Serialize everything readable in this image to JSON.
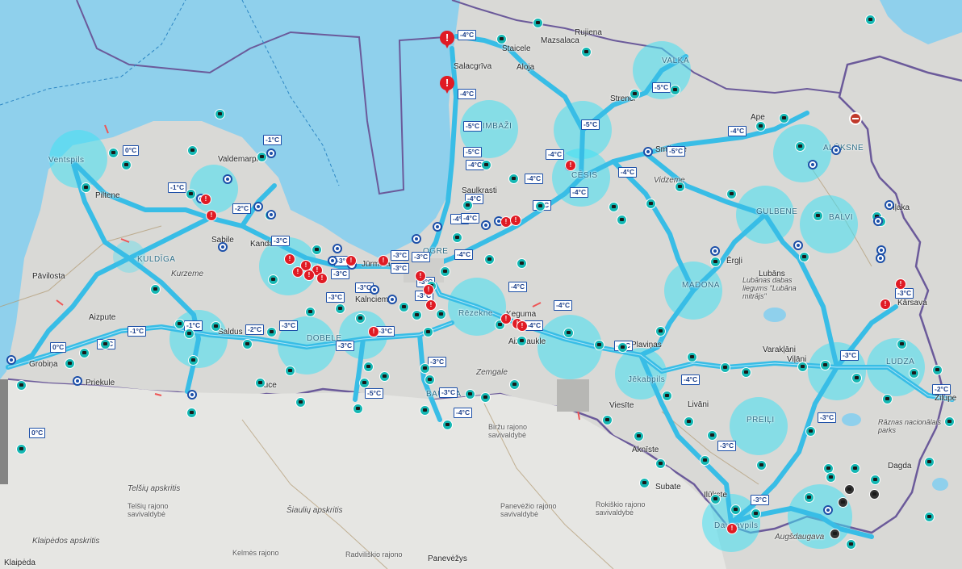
{
  "map": {
    "title": "",
    "colors": {
      "sea": "#8fd0ec",
      "land": "#d9d9d6",
      "road": "#38bde6",
      "zone": "#41e0f4",
      "border": "#6b5a9a",
      "alert": "#e01b24",
      "temp_text": "#1c3f8a"
    }
  },
  "places": [
    {
      "text": "Ventspils",
      "kind": "ct"
    },
    {
      "text": "Valdemarpils",
      "kind": "n"
    },
    {
      "text": "Piltene",
      "kind": "n"
    },
    {
      "text": "Sabile",
      "kind": "n"
    },
    {
      "text": "Kandava",
      "kind": "n"
    },
    {
      "text": "KULDĪGA",
      "kind": "ct"
    },
    {
      "text": "Kurzeme",
      "kind": "it"
    },
    {
      "text": "Pāvilosta",
      "kind": "n"
    },
    {
      "text": "Aizpute",
      "kind": "n"
    },
    {
      "text": "Saldus",
      "kind": "n"
    },
    {
      "text": "Grobiņa",
      "kind": "n"
    },
    {
      "text": "Priekule",
      "kind": "n"
    },
    {
      "text": "Auce",
      "kind": "n"
    },
    {
      "text": "DOBELE",
      "kind": "ct"
    },
    {
      "text": "Kalnciems",
      "kind": "n"
    },
    {
      "text": "Jūrmala",
      "kind": "n"
    },
    {
      "text": "Zemgale",
      "kind": "it"
    },
    {
      "text": "BAUSKA",
      "kind": "ct"
    },
    {
      "text": "Salacgrīva",
      "kind": "n"
    },
    {
      "text": "Staicele",
      "kind": "n"
    },
    {
      "text": "Aloja",
      "kind": "n"
    },
    {
      "text": "Mazsalaca",
      "kind": "n"
    },
    {
      "text": "Rujiena",
      "kind": "n"
    },
    {
      "text": "LIMBAŽI",
      "kind": "ct"
    },
    {
      "text": "VALKA",
      "kind": "ct"
    },
    {
      "text": "Strenči",
      "kind": "n"
    },
    {
      "text": "Saulkrasti",
      "kind": "n"
    },
    {
      "text": "CĒSIS",
      "kind": "ct"
    },
    {
      "text": "Vidzeme",
      "kind": "it"
    },
    {
      "text": "Smiltene",
      "kind": "n"
    },
    {
      "text": "Ape",
      "kind": "n"
    },
    {
      "text": "ALŪKSNE",
      "kind": "ct"
    },
    {
      "text": "GULBENE",
      "kind": "ct"
    },
    {
      "text": "BALVI",
      "kind": "ct"
    },
    {
      "text": "Viļaka",
      "kind": "n"
    },
    {
      "text": "Lubāns",
      "kind": "n"
    },
    {
      "text": "Lubānas dabas liegums \"Lubāna mitrājs\"",
      "kind": "it"
    },
    {
      "text": "MADONA",
      "kind": "ct"
    },
    {
      "text": "Ērgļi",
      "kind": "n"
    },
    {
      "text": "Varakļāni",
      "kind": "n"
    },
    {
      "text": "Viļāni",
      "kind": "n"
    },
    {
      "text": "Kārsava",
      "kind": "n"
    },
    {
      "text": "LUDZA",
      "kind": "ct"
    },
    {
      "text": "Zilupe",
      "kind": "n"
    },
    {
      "text": "Rāznas nacionālais parks",
      "kind": "it"
    },
    {
      "text": "Dagda",
      "kind": "n"
    },
    {
      "text": "OGRE",
      "kind": "ct"
    },
    {
      "text": "Ķeguma",
      "kind": "n"
    },
    {
      "text": "Aizkraukle",
      "kind": "n"
    },
    {
      "text": "Jēkabpils",
      "kind": "ct"
    },
    {
      "text": "Plaviņas",
      "kind": "n"
    },
    {
      "text": "Livāni",
      "kind": "n"
    },
    {
      "text": "Viesīte",
      "kind": "n"
    },
    {
      "text": "PREIĻI",
      "kind": "ct"
    },
    {
      "text": "Aknīste",
      "kind": "n"
    },
    {
      "text": "Subate",
      "kind": "n"
    },
    {
      "text": "Ilūkste",
      "kind": "n"
    },
    {
      "text": "Daugavpils",
      "kind": "ct"
    },
    {
      "text": "Augšdaugava",
      "kind": "it"
    },
    {
      "text": "Biržu rajono savivaldybė",
      "kind": "sm"
    },
    {
      "text": "Rokiškio rajono savivaldybė",
      "kind": "sm"
    },
    {
      "text": "Telšių apskritis",
      "kind": "it"
    },
    {
      "text": "Telšių rajono savivaldybė",
      "kind": "sm"
    },
    {
      "text": "Šiaulių apskritis",
      "kind": "it"
    },
    {
      "text": "Panevėžio rajono savivaldybė",
      "kind": "sm"
    },
    {
      "text": "Klaipėdos apskritis",
      "kind": "it"
    },
    {
      "text": "Kelmės rajono",
      "kind": "sm"
    },
    {
      "text": "Radviliškio rajono",
      "kind": "sm"
    },
    {
      "text": "Panevėžys",
      "kind": "n"
    },
    {
      "text": "Klaipėda",
      "kind": "n"
    },
    {
      "text": "Rēzekne",
      "kind": "ct"
    }
  ],
  "temperatures": [
    "-4°C",
    "-4°C",
    "-5°C",
    "-5°C",
    "-4°C",
    "-5°C",
    "-4°C",
    "-4°C",
    "-4°C",
    "-5°C",
    "-4°C",
    "-5°C",
    "-4°C",
    "-3°C",
    "-4°C",
    "-4°C",
    "0°C",
    "-1°C",
    "-1°C",
    "-2°C",
    "-3°C",
    "-3°C",
    "-3°C",
    "-3°C",
    "-1°C",
    "-1°C",
    "0°C",
    "-1°C",
    "-2°C",
    "-3°C",
    "-3°C",
    "-3°C",
    "-3°C",
    "-3°C",
    "-3°C",
    "-4°C",
    "-4°C",
    "-3°C",
    "-3°C",
    "-3°C",
    "-4°C",
    "-3°C",
    "-4°C",
    "-4°C",
    "-3°C",
    "-2°C",
    "-3°C",
    "-3°C",
    "-3°C",
    "-3°C",
    "-3°C",
    "-5°C",
    "0°C",
    "-4°C",
    "-3°C",
    "-4°C"
  ]
}
